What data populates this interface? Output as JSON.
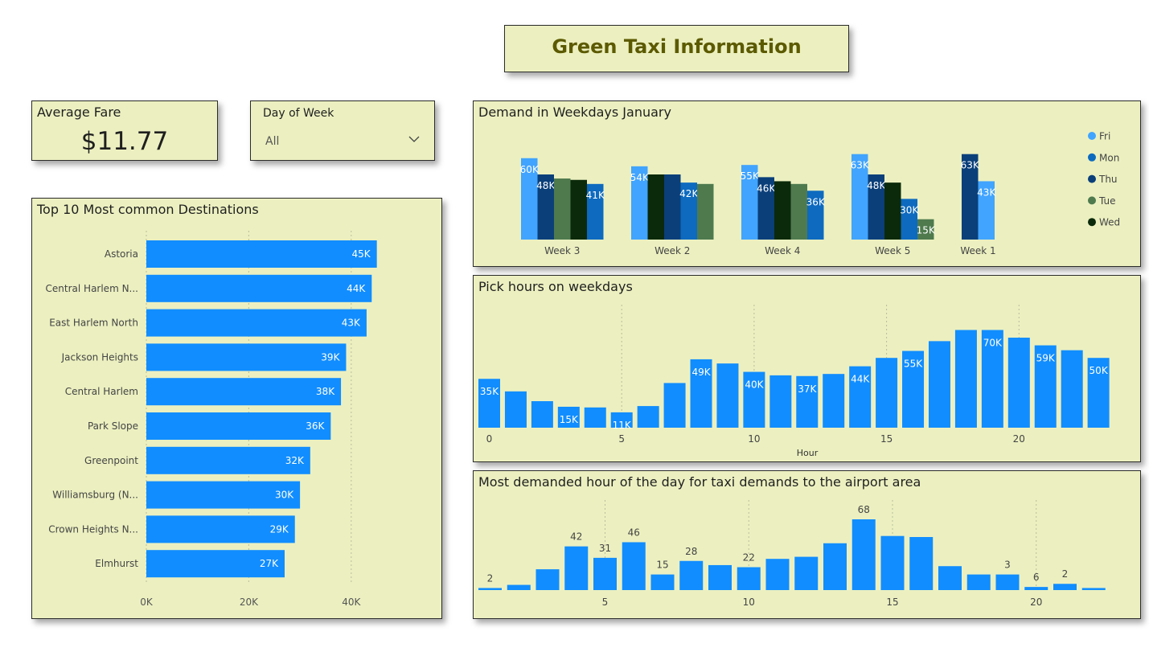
{
  "header": {
    "title": "Green Taxi Information"
  },
  "average_fare": {
    "label": "Average Fare",
    "value": "$11.77"
  },
  "day_of_week": {
    "label": "Day of Week",
    "selected": "All"
  },
  "colors": {
    "bar": "#118dff",
    "fri": "#41a4ff",
    "mon": "#0d6abf",
    "thu": "#0a3f7a",
    "tue": "#4e7a4e",
    "wed": "#0b2a0b",
    "panel": "#ecf0c0"
  },
  "chart_data": [
    {
      "id": "destinations",
      "type": "bar",
      "orientation": "horizontal",
      "title": "Top 10 Most common Destinations",
      "categories": [
        "Astoria",
        "Central Harlem N...",
        "East Harlem North",
        "Jackson Heights",
        "Central Harlem",
        "Park Slope",
        "Greenpoint",
        "Williamsburg (N...",
        "Crown Heights N...",
        "Elmhurst"
      ],
      "values": [
        45000,
        44000,
        43000,
        39000,
        38000,
        36000,
        32000,
        30000,
        29000,
        27000
      ],
      "data_labels": [
        "45K",
        "44K",
        "43K",
        "39K",
        "38K",
        "36K",
        "32K",
        "30K",
        "29K",
        "27K"
      ],
      "xticks": [
        0,
        20000,
        40000
      ],
      "xtick_labels": [
        "0K",
        "20K",
        "40K"
      ],
      "xlim": [
        0,
        54000
      ]
    },
    {
      "id": "weekdays",
      "type": "bar",
      "title": "Demand in Weekdays January",
      "categories": [
        "Week 3",
        "Week 2",
        "Week 4",
        "Week 5",
        "Week 1"
      ],
      "series": [
        {
          "name": "Fri",
          "values": [
            60000,
            54000,
            55000,
            63000,
            43000
          ]
        },
        {
          "name": "Mon",
          "values": [
            41000,
            42000,
            36000,
            30000,
            null
          ]
        },
        {
          "name": "Thu",
          "values": [
            48000,
            48000,
            46000,
            48000,
            63000
          ]
        },
        {
          "name": "Tue",
          "values": [
            45000,
            41000,
            41000,
            15000,
            null
          ]
        },
        {
          "name": "Wed",
          "values": [
            44000,
            48000,
            43000,
            42000,
            null
          ]
        }
      ],
      "bar_order": [
        [
          "Fri",
          "Thu",
          "Tue",
          "Wed",
          "Mon"
        ],
        [
          "Fri",
          "Wed",
          "Thu",
          "Mon",
          "Tue"
        ],
        [
          "Fri",
          "Thu",
          "Wed",
          "Tue",
          "Mon"
        ],
        [
          "Fri",
          "Thu",
          "Wed",
          "Mon",
          "Tue"
        ],
        [
          "Thu",
          "Fri"
        ]
      ],
      "point_labels": [
        {
          "category": "Week 3",
          "series": "Fri",
          "text": "60K"
        },
        {
          "category": "Week 3",
          "series": "Thu",
          "text": "48K"
        },
        {
          "category": "Week 3",
          "series": "Mon",
          "text": "41K"
        },
        {
          "category": "Week 2",
          "series": "Fri",
          "text": "54K"
        },
        {
          "category": "Week 2",
          "series": "Mon",
          "text": "42K"
        },
        {
          "category": "Week 4",
          "series": "Fri",
          "text": "55K"
        },
        {
          "category": "Week 4",
          "series": "Thu",
          "text": "46K"
        },
        {
          "category": "Week 4",
          "series": "Mon",
          "text": "36K"
        },
        {
          "category": "Week 5",
          "series": "Fri",
          "text": "63K"
        },
        {
          "category": "Week 5",
          "series": "Thu",
          "text": "48K"
        },
        {
          "category": "Week 5",
          "series": "Mon",
          "text": "30K"
        },
        {
          "category": "Week 5",
          "series": "Tue",
          "text": "15K"
        },
        {
          "category": "Week 1",
          "series": "Thu",
          "text": "63K"
        },
        {
          "category": "Week 1",
          "series": "Fri",
          "text": "43K"
        }
      ],
      "legend_position": "right",
      "ylim": [
        0,
        64000
      ]
    },
    {
      "id": "pickhours",
      "type": "bar",
      "title": "Pick hours on weekdays",
      "xlabel": "Hour",
      "x": [
        0,
        1,
        2,
        3,
        4,
        5,
        6,
        7,
        8,
        9,
        10,
        11,
        12,
        13,
        14,
        15,
        16,
        17,
        18,
        19,
        20,
        21,
        22,
        23
      ],
      "values": [
        35000,
        26000,
        19000,
        15000,
        14500,
        11000,
        15500,
        32000,
        49000,
        46000,
        40000,
        37500,
        37000,
        38500,
        44000,
        50000,
        55000,
        62000,
        70000,
        70000,
        64500,
        59000,
        55500,
        50000
      ],
      "point_labels": [
        {
          "x": 0,
          "text": "35K"
        },
        {
          "x": 3,
          "text": "15K"
        },
        {
          "x": 5,
          "text": "11K"
        },
        {
          "x": 8,
          "text": "49K"
        },
        {
          "x": 10,
          "text": "40K"
        },
        {
          "x": 12,
          "text": "37K"
        },
        {
          "x": 14,
          "text": "44K"
        },
        {
          "x": 16,
          "text": "55K"
        },
        {
          "x": 19,
          "text": "70K"
        },
        {
          "x": 21,
          "text": "59K"
        },
        {
          "x": 23,
          "text": "50K"
        }
      ],
      "xticks": [
        0,
        5,
        10,
        15,
        20
      ],
      "ylim": [
        0,
        72000
      ]
    },
    {
      "id": "airport",
      "type": "bar",
      "title": "Most demanded hour of the day for taxi demands to the airport area",
      "x": [
        1,
        2,
        3,
        4,
        5,
        6,
        7,
        8,
        9,
        10,
        11,
        12,
        13,
        14,
        15,
        16,
        17,
        18,
        19,
        20,
        21,
        22,
        23
      ],
      "values": [
        2,
        5,
        20,
        42,
        31,
        46,
        15,
        28,
        24,
        22,
        30,
        32,
        45,
        68,
        52,
        51,
        23,
        15,
        15,
        3,
        6,
        2,
        0
      ],
      "point_labels": [
        {
          "x": 1,
          "text": "2"
        },
        {
          "x": 4,
          "text": "42"
        },
        {
          "x": 5,
          "text": "31"
        },
        {
          "x": 6,
          "text": "46"
        },
        {
          "x": 7,
          "text": "15"
        },
        {
          "x": 8,
          "text": "28"
        },
        {
          "x": 10,
          "text": "22"
        },
        {
          "x": 14,
          "text": "68"
        },
        {
          "x": 19,
          "text": "3"
        },
        {
          "x": 20,
          "text": "6"
        },
        {
          "x": 21,
          "text": "2"
        }
      ],
      "xticks": [
        5,
        10,
        15,
        20
      ],
      "ylim": [
        0,
        68
      ]
    }
  ]
}
